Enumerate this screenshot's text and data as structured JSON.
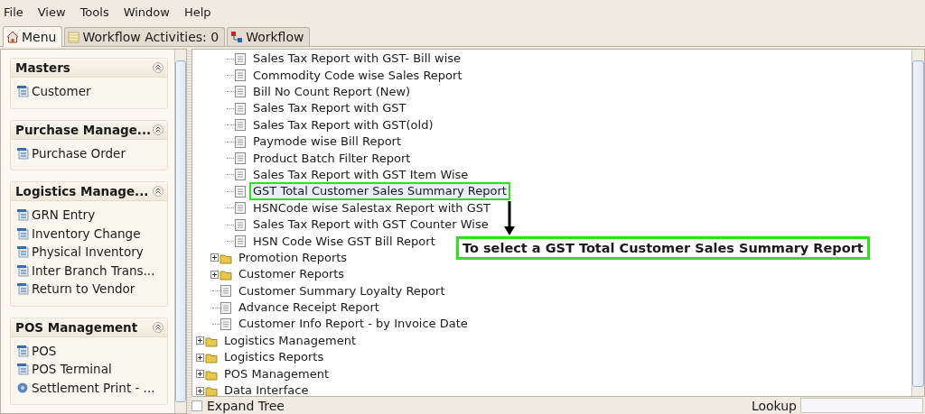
{
  "menu_bar": [
    "File",
    "View",
    "Tools",
    "Window",
    "Help"
  ],
  "tabs": [
    {
      "label": "Menu",
      "selected": true
    },
    {
      "label": "Workflow Activities: 0",
      "selected": false
    },
    {
      "label": "Workflow",
      "selected": false
    }
  ],
  "sidebar": {
    "sections": [
      {
        "title": "Masters",
        "expanded": true,
        "items": [
          {
            "label": "Customer",
            "kind": "form"
          }
        ]
      },
      {
        "title": "Purchase Manage...",
        "expanded": true,
        "items": [
          {
            "label": "Purchase Order",
            "kind": "form"
          }
        ]
      },
      {
        "title": "Logistics Manage...",
        "expanded": true,
        "items": [
          {
            "label": "GRN Entry",
            "kind": "form"
          },
          {
            "label": "Inventory Change",
            "kind": "form"
          },
          {
            "label": "Physical Inventory",
            "kind": "form"
          },
          {
            "label": "Inter Branch Trans...",
            "kind": "form"
          },
          {
            "label": "Return to Vendor",
            "kind": "form"
          }
        ]
      },
      {
        "title": "POS Management",
        "expanded": true,
        "items": [
          {
            "label": "POS",
            "kind": "form"
          },
          {
            "label": "POS Terminal",
            "kind": "form"
          },
          {
            "label": "Settlement Print - ...",
            "kind": "process"
          }
        ]
      }
    ]
  },
  "tree": {
    "nodes": [
      {
        "children": [
          {
            "children": [
              {
                "kind": "report",
                "label": "Sales Tax Report with GST- Bill wise",
                "selected": false
              },
              {
                "kind": "report",
                "label": "Commodity Code wise Sales Report",
                "selected": false
              },
              {
                "kind": "report",
                "label": "Bill No Count Report (New)",
                "selected": false
              },
              {
                "kind": "report",
                "label": "Sales Tax Report with GST",
                "selected": false
              },
              {
                "kind": "report",
                "label": "Sales Tax Report with GST(old)",
                "selected": false
              },
              {
                "kind": "report",
                "label": "Paymode wise Bill Report",
                "selected": false
              },
              {
                "kind": "report",
                "label": "Product Batch Filter Report",
                "selected": false
              },
              {
                "kind": "report",
                "label": "Sales Tax Report with GST Item Wise",
                "selected": false
              },
              {
                "kind": "report",
                "label": "GST Total Customer Sales Summary Report",
                "selected": true
              },
              {
                "kind": "report",
                "label": "HSNCode wise Salestax Report with GST",
                "selected": false
              },
              {
                "kind": "report",
                "label": "Sales Tax Report with GST Counter Wise",
                "selected": false
              },
              {
                "kind": "report",
                "label": "HSN Code Wise GST Bill Report",
                "selected": false
              }
            ]
          },
          {
            "kind": "folder",
            "label": "Promotion Reports",
            "expanded": false,
            "selected": false
          },
          {
            "kind": "folder",
            "label": "Customer Reports",
            "expanded": false,
            "selected": false
          },
          {
            "kind": "report",
            "label": "Customer Summary Loyalty Report",
            "selected": false
          },
          {
            "kind": "report",
            "label": "Advance Receipt Report",
            "selected": false
          },
          {
            "kind": "report",
            "label": "Customer Info Report - by Invoice Date",
            "selected": false
          }
        ]
      },
      {
        "kind": "folder",
        "label": "Logistics Management",
        "expanded": false,
        "selected": false
      },
      {
        "kind": "folder",
        "label": "Logistics Reports",
        "expanded": false,
        "selected": false
      },
      {
        "kind": "folder",
        "label": "POS Management",
        "expanded": false,
        "selected": false
      },
      {
        "kind": "folder",
        "label": "Data Interface",
        "expanded": false,
        "selected": false
      }
    ]
  },
  "callout": {
    "text": "To select a GST Total Customer Sales Summary Report"
  },
  "bottom_bar": {
    "expand_tree": {
      "label": "Expand Tree",
      "checked": false
    },
    "lookup": {
      "label": "Lookup"
    }
  }
}
